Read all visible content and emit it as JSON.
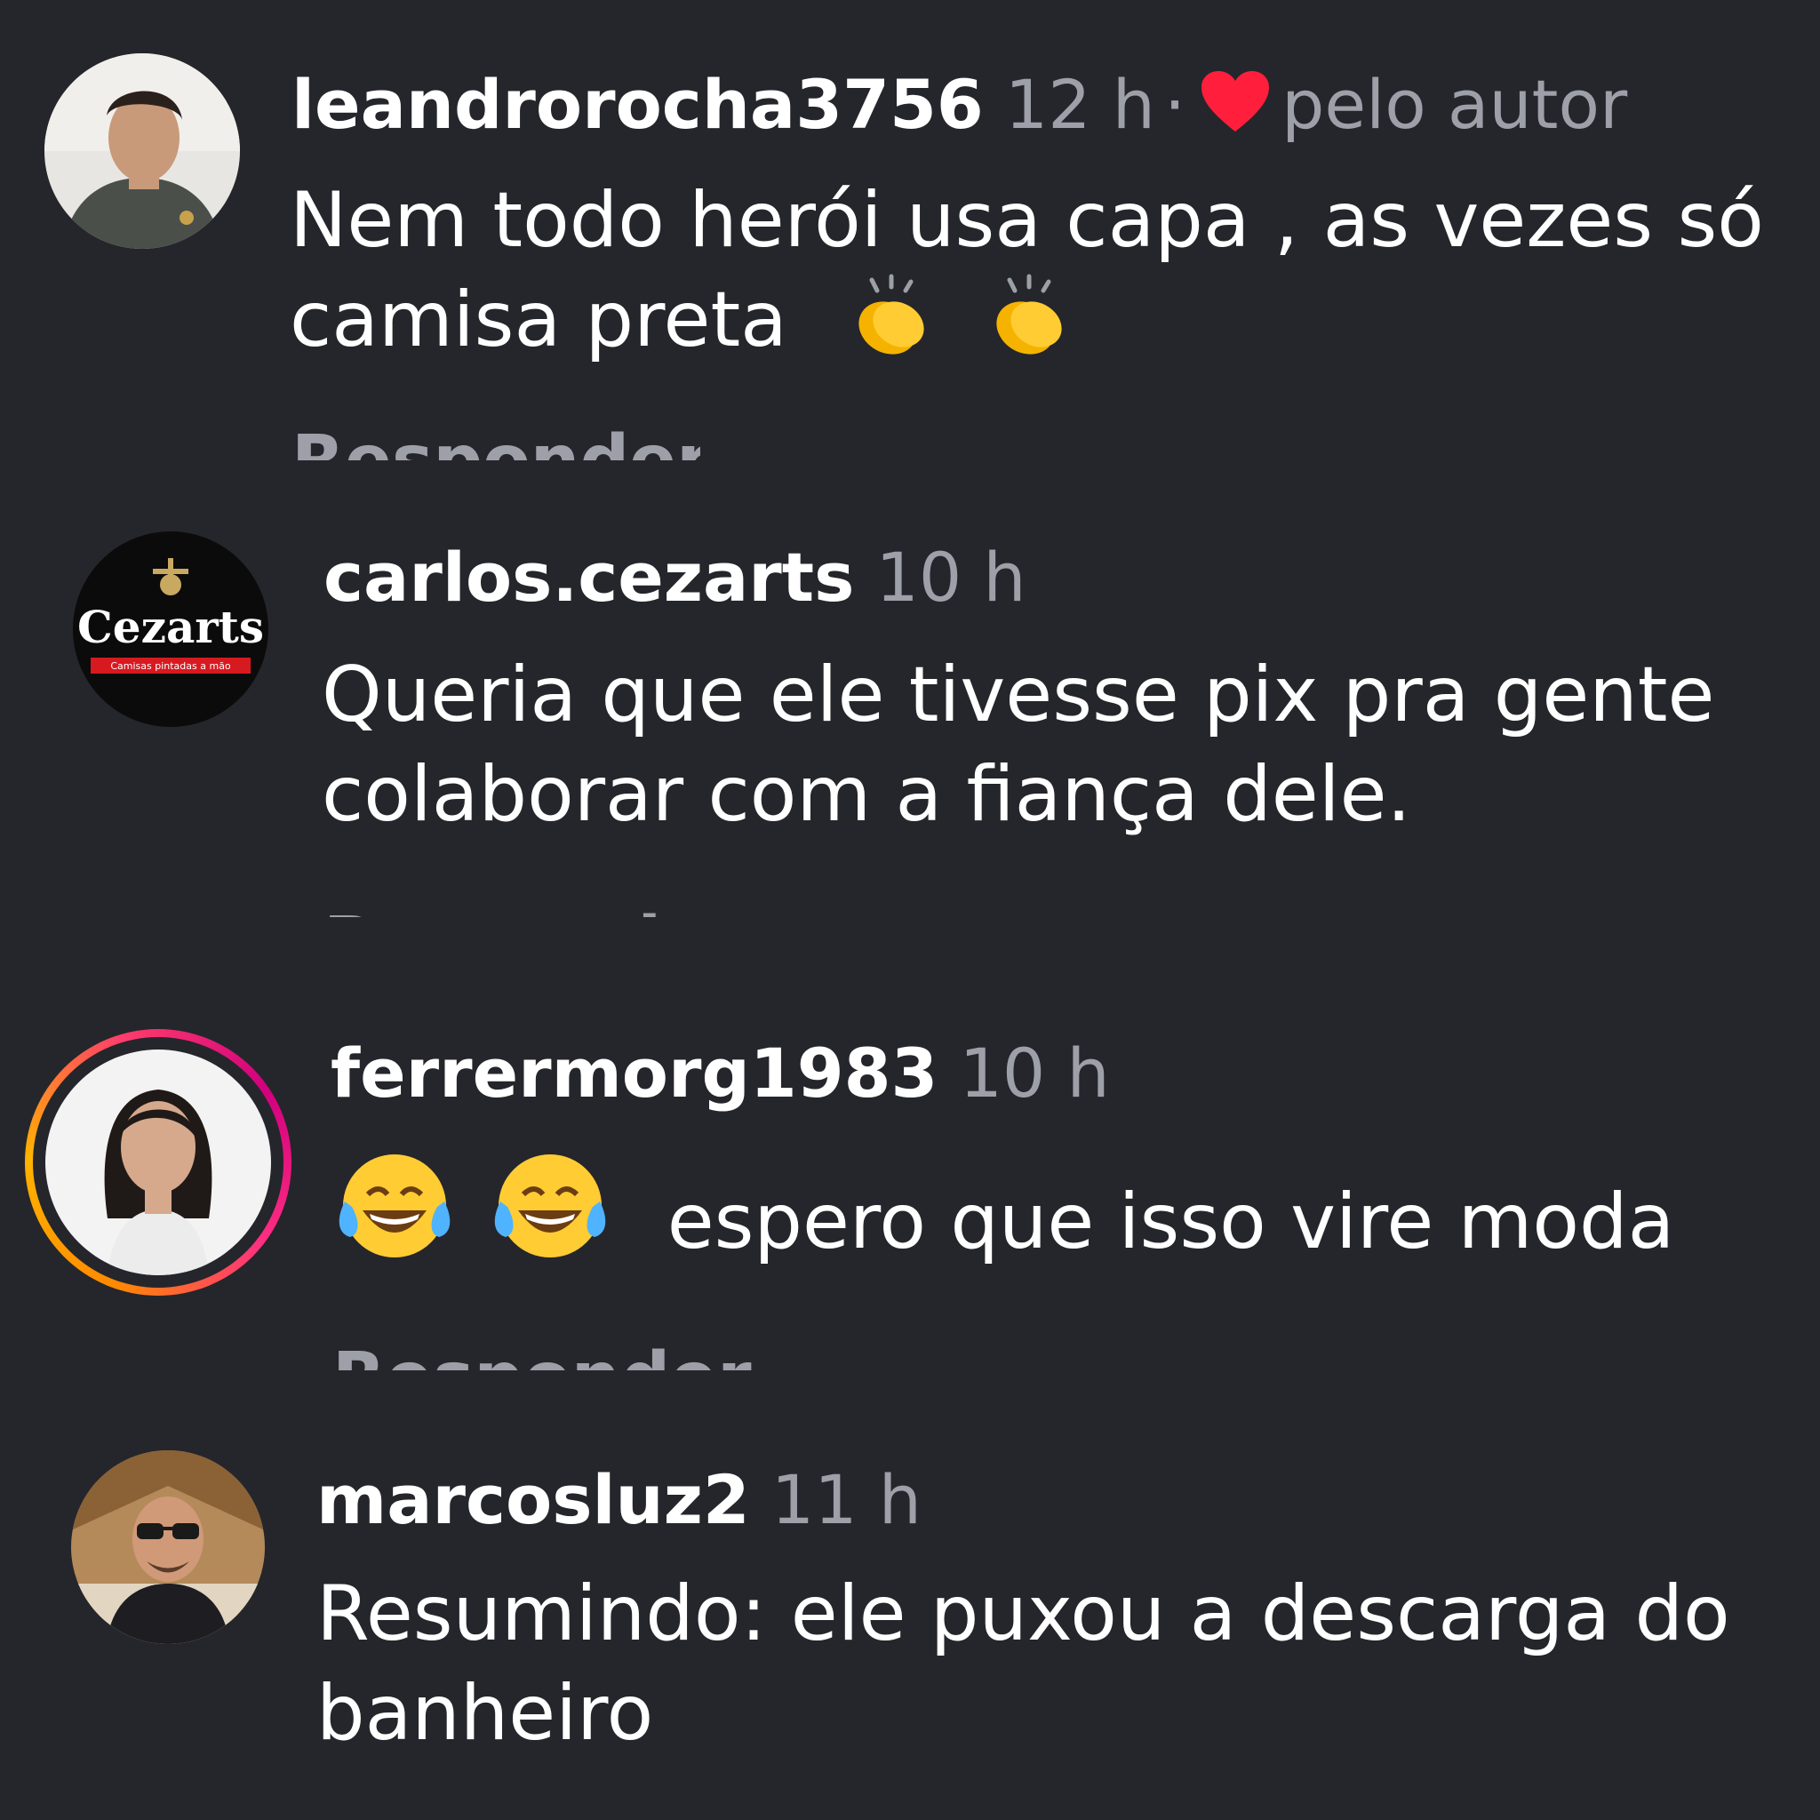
{
  "comments": [
    {
      "username": "leandrorocha3756",
      "time": "12 h",
      "separator": "·",
      "liked_by_author": "pelo autor",
      "text_lines": [
        "Nem todo herói usa capa , as vezes só",
        "camisa preta"
      ],
      "emojis": [
        "clapping-hands",
        "clapping-hands"
      ],
      "reply_label": "Responder"
    },
    {
      "username": "carlos.cezarts",
      "time": "10 h",
      "avatar_logo_text": "Cezarts",
      "avatar_logo_subtext": "Camisas pintadas a mão",
      "text_lines": [
        "Queria que ele tivesse pix pra gente",
        "colaborar com a fiança dele."
      ],
      "reply_label": "Responder"
    },
    {
      "username": "ferrermorg1983",
      "time": "10 h",
      "has_story_ring": true,
      "emojis": [
        "face-with-tears-of-joy",
        "face-with-tears-of-joy"
      ],
      "text_lines": [
        "espero que isso vire moda"
      ],
      "reply_label": "Responder"
    },
    {
      "username": "marcosluz2",
      "time": "11 h",
      "text_lines": [
        "Resumindo: ele puxou a descarga do",
        "banheiro"
      ]
    }
  ],
  "colors": {
    "background": "#25262b",
    "text": "#ffffff",
    "secondary": "#9da0a8",
    "heart": "#ff1f3d"
  }
}
